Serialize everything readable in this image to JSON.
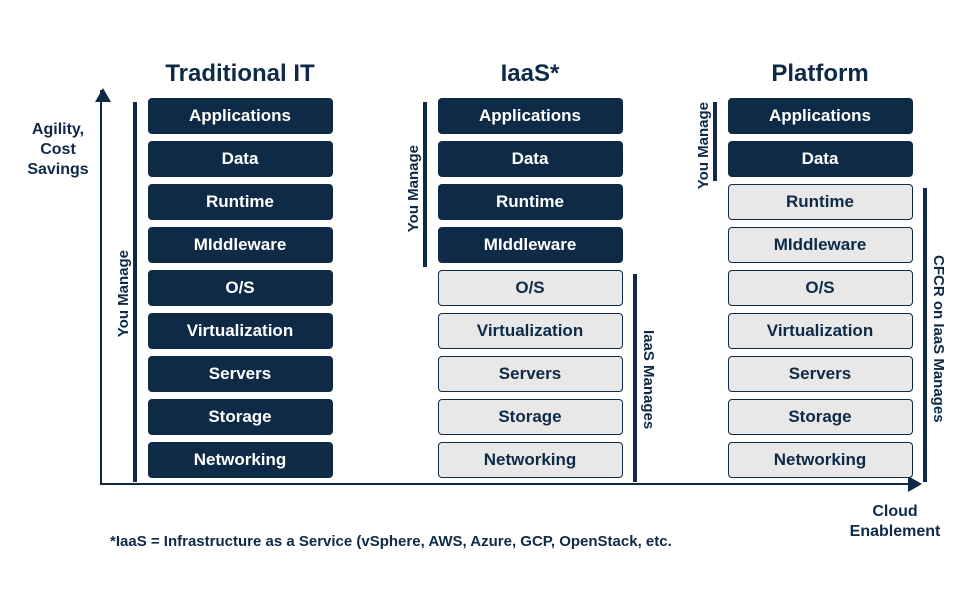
{
  "axes": {
    "y": "Agility,\nCost Savings",
    "x": "Cloud\nEnablement"
  },
  "footnote": "*IaaS = Infrastructure as a Service (vSphere, AWS, Azure, GCP, OpenStack, etc.",
  "columns": {
    "traditional": {
      "title": "Traditional IT",
      "left_label": "You Manage",
      "layers": [
        "Applications",
        "Data",
        "Runtime",
        "MIddleware",
        "O/S",
        "Virtualization",
        "Servers",
        "Storage",
        "Networking"
      ]
    },
    "iaas": {
      "title": "IaaS*",
      "left_label": "You Manage",
      "right_label": "IaaS Manages",
      "layers": [
        "Applications",
        "Data",
        "Runtime",
        "MIddleware",
        "O/S",
        "Virtualization",
        "Servers",
        "Storage",
        "Networking"
      ]
    },
    "platform": {
      "title": "Platform",
      "left_label": "You Manage",
      "right_label": "CFCR on IaaS Manages",
      "layers": [
        "Applications",
        "Data",
        "Runtime",
        "MIddleware",
        "O/S",
        "Virtualization",
        "Servers",
        "Storage",
        "Networking"
      ]
    }
  },
  "chart_data": {
    "type": "table",
    "title": "Cloud service model responsibility comparison",
    "categories": [
      "Applications",
      "Data",
      "Runtime",
      "Middleware",
      "O/S",
      "Virtualization",
      "Servers",
      "Storage",
      "Networking"
    ],
    "series": [
      {
        "name": "Traditional IT",
        "values": [
          "You Manage",
          "You Manage",
          "You Manage",
          "You Manage",
          "You Manage",
          "You Manage",
          "You Manage",
          "You Manage",
          "You Manage"
        ]
      },
      {
        "name": "IaaS",
        "values": [
          "You Manage",
          "You Manage",
          "You Manage",
          "You Manage",
          "IaaS Manages",
          "IaaS Manages",
          "IaaS Manages",
          "IaaS Manages",
          "IaaS Manages"
        ]
      },
      {
        "name": "Platform",
        "values": [
          "You Manage",
          "You Manage",
          "CFCR on IaaS Manages",
          "CFCR on IaaS Manages",
          "CFCR on IaaS Manages",
          "CFCR on IaaS Manages",
          "CFCR on IaaS Manages",
          "CFCR on IaaS Manages",
          "CFCR on IaaS Manages"
        ]
      }
    ],
    "xlabel": "Cloud Enablement",
    "ylabel": "Agility, Cost Savings"
  }
}
